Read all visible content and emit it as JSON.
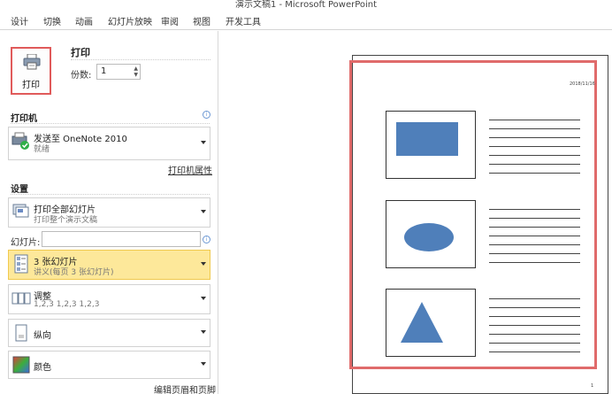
{
  "window": {
    "title": "演示文稿1 - Microsoft PowerPoint"
  },
  "ribbon": {
    "tabs": [
      "设计",
      "切换",
      "动画",
      "幻灯片放映",
      "审阅",
      "视图",
      "开发工具"
    ]
  },
  "print": {
    "button_label": "打印",
    "title": "打印",
    "copies_label": "份数:",
    "copies_value": "1"
  },
  "printer": {
    "heading": "打印机",
    "name": "发送至 OneNote 2010",
    "status": "就绪",
    "properties_link": "打印机属性"
  },
  "settings": {
    "heading": "设置",
    "range_title": "打印全部幻灯片",
    "range_sub": "打印整个演示文稿",
    "slides_label": "幻灯片:",
    "slides_value": "",
    "layout_title": "3 张幻灯片",
    "layout_sub": "讲义(每页 3 张幻灯片)",
    "collate_title": "调整",
    "collate_sub": "1,2,3    1,2,3    1,2,3",
    "orientation": "纵向",
    "color": "颜色",
    "header_footer_link": "编辑页眉和页脚"
  },
  "preview": {
    "date": "2018/11/16",
    "page_number": "1"
  }
}
